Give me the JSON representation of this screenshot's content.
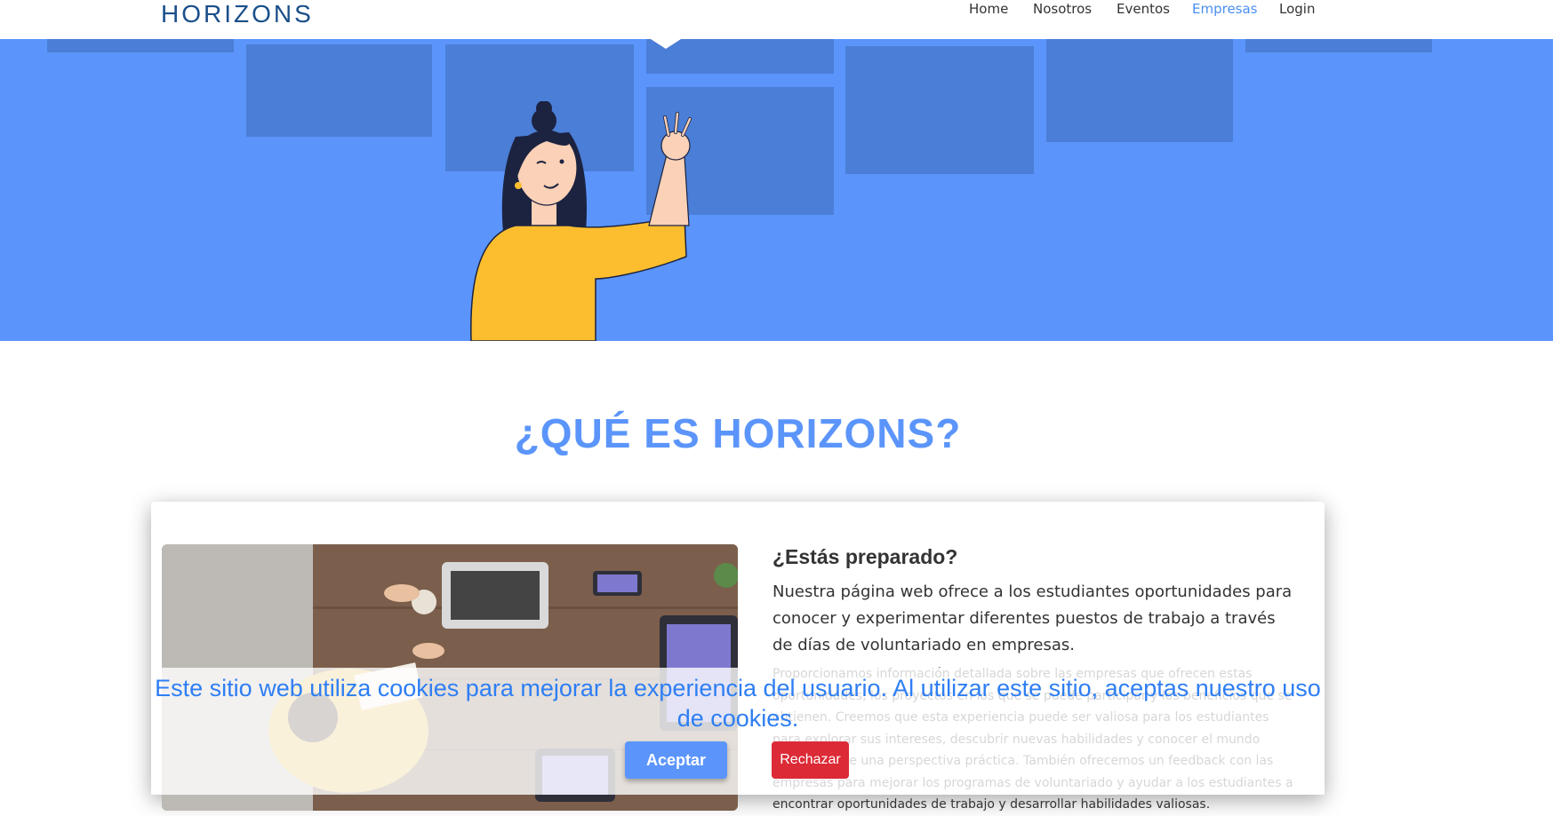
{
  "brand": "HORIZONS",
  "nav": {
    "items": [
      {
        "label": "Home"
      },
      {
        "label": "Nosotros"
      },
      {
        "label": "Eventos"
      },
      {
        "label": "Empresas",
        "active": true
      },
      {
        "label": "Login"
      }
    ]
  },
  "hero": {
    "background_color": "#5b95fb",
    "illustration": "woman-ok-gesture-illustration"
  },
  "section": {
    "title": "¿QUÉ ES HORIZONS?"
  },
  "card": {
    "image": "team-meeting-laptops-photo",
    "heading": "¿Estás preparado?",
    "lead": "Nuestra página web ofrece a los estudiantes oportunidades para conocer y experimentar diferentes puestos de trabajo a través de días de voluntariado en empresas.",
    "body": "Proporcionamos información detallada sobre las empresas que ofrecen estas oportunidades, los proyectos en los que se puede participar y los beneficios que se obtienen. Creemos que esta experiencia puede ser valiosa para los estudiantes para explorar sus intereses, descubrir nuevas habilidades y conocer el mundo laboral desde una perspectiva práctica. También ofrecemos un feedback con las empresas para mejorar los programas de voluntariado y ayudar a los estudiantes a encontrar oportunidades de trabajo y desarrollar habilidades valiosas."
  },
  "cookie_banner": {
    "message": "Este sitio web utiliza cookies para mejorar la experiencia del usuario. Al utilizar este sitio, aceptas nuestro uso de cookies.",
    "accept_label": "Aceptar",
    "reject_label": "Rechazar"
  },
  "colors": {
    "accent": "#5b95fb",
    "brand": "#1a4f8b",
    "reject": "#dc2a36"
  }
}
